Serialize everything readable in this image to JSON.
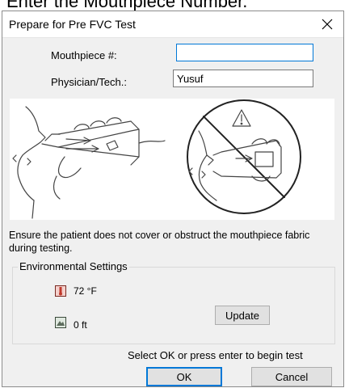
{
  "caption": "Enter the Mouthpiece Number.",
  "dialog": {
    "title": "Prepare for Pre FVC Test",
    "close_symbol": "✕"
  },
  "form": {
    "mouthpiece_label": "Mouthpiece #:",
    "mouthpiece_value": "",
    "physician_label": "Physician/Tech.:",
    "physician_value": "Yusuf"
  },
  "notice": "Ensure the patient does not cover or obstruct the mouthpiece fabric during testing.",
  "environment": {
    "group_label": "Environmental Settings",
    "temperature": "72 °F",
    "temperature_icon": "thermometer-icon",
    "altitude": "0 ft",
    "altitude_icon": "mountain-icon",
    "update_label": "Update"
  },
  "footer": {
    "instruction": "Select OK or press enter to begin test",
    "ok_label": "OK",
    "cancel_label": "Cancel"
  },
  "colors": {
    "accent": "#0078d7",
    "dialog_bg": "#f0f0f0",
    "thermometer_red": "#c0392b"
  }
}
